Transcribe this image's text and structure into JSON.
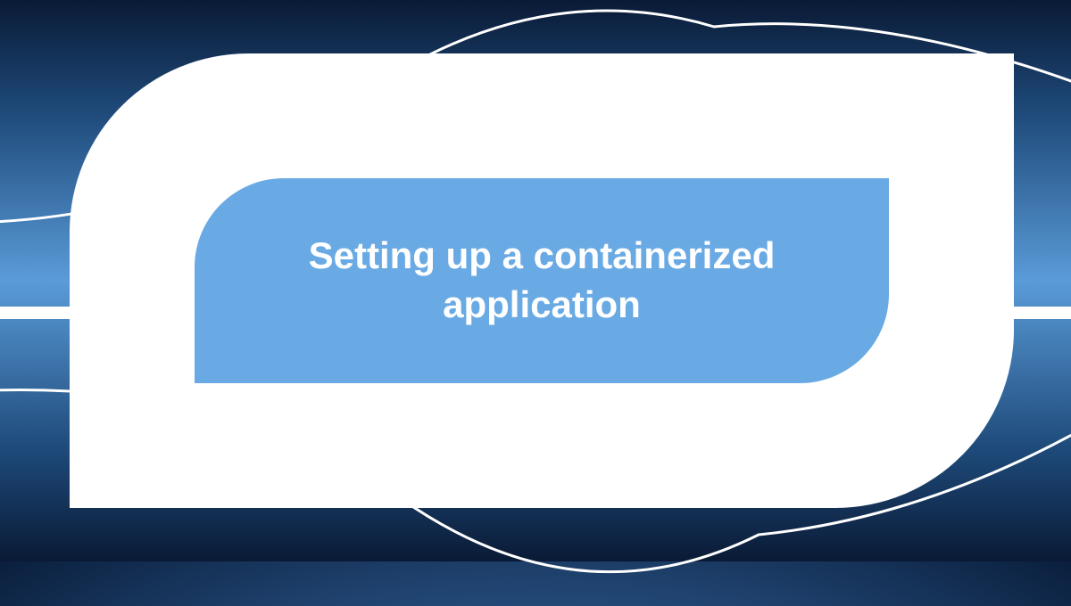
{
  "hero": {
    "title": "Setting up a containerized application"
  },
  "colors": {
    "inner_panel": "#6aaae4",
    "outer_panel": "#ffffff",
    "background_dark": "#0a1a35",
    "background_mid": "#5a9bd8"
  }
}
